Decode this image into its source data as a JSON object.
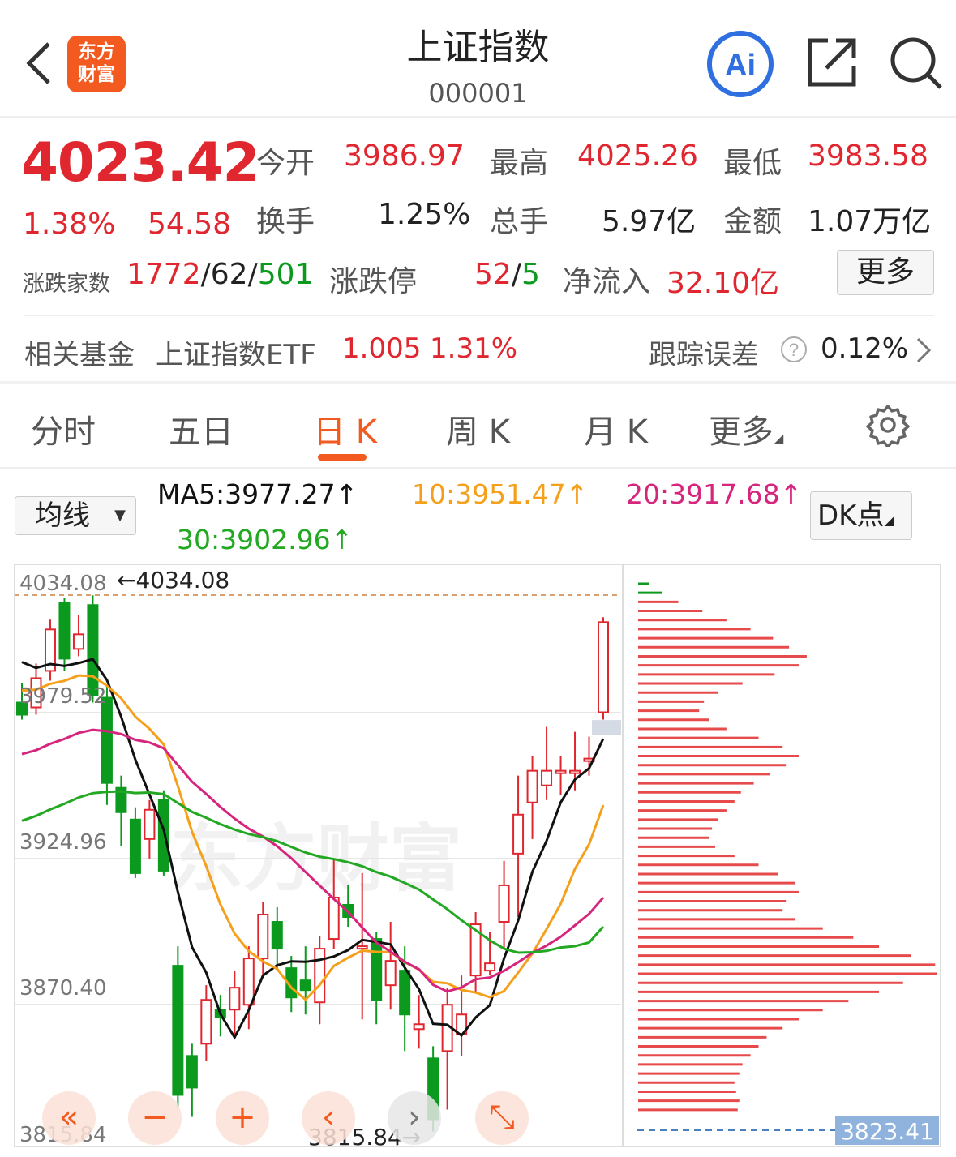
{
  "header": {
    "title": "上证指数",
    "code": "000001",
    "logo_line1": "东方",
    "logo_line2": "财富",
    "ai_label": "Ai"
  },
  "quote": {
    "price": "4023.42",
    "change_pct": "1.38%",
    "change": "54.58",
    "open_label": "今开",
    "open": "3986.97",
    "high_label": "最高",
    "high": "4025.26",
    "low_label": "最低",
    "low": "3983.58",
    "turnover_label": "换手",
    "turnover": "1.25%",
    "volume_label": "总手",
    "volume": "5.97亿",
    "amount_label": "金额",
    "amount": "1.07万亿",
    "breadth_label": "涨跌家数",
    "breadth_up": "1772",
    "breadth_flat": "62",
    "breadth_down": "501",
    "slash": "/",
    "limit_label": "涨跌停",
    "limit_up": "52",
    "limit_down": "5",
    "netflow_label": "净流入",
    "netflow": "32.10亿",
    "more": "更多"
  },
  "fund": {
    "label": "相关基金",
    "name": "上证指数ETF",
    "price": "1.005",
    "change": "1.31%",
    "error_label": "跟踪误差",
    "error": "0.12%"
  },
  "tabs": [
    "分时",
    "五日",
    "日 K",
    "周 K",
    "月 K",
    "更多"
  ],
  "active_tab": 2,
  "ma": {
    "select": "均线",
    "ma5": "MA5:3977.27↑",
    "ma10": "10:3951.47↑",
    "ma20": "20:3917.68↑",
    "ma30": "30:3902.96↑",
    "dk": "DK点"
  },
  "colors": {
    "up": "#e0262f",
    "down": "#0b9a1e",
    "accent": "#f25a1f",
    "ma5": "#111111",
    "ma10": "#f5a01a",
    "ma20": "#d6257d",
    "ma30": "#22a822"
  },
  "chart_data": {
    "type": "candlestick",
    "y_ticks": [
      "4034.08",
      "3979.52",
      "3924.96",
      "3870.40",
      "3815.84"
    ],
    "ylim": [
      3815.84,
      4034.08
    ],
    "max_label": "←4034.08",
    "min_label": "3815.84→",
    "current_price_label": "3823.41",
    "watermark": "东方财富",
    "candles": [
      {
        "o": 3990,
        "c": 3985,
        "h": 3998,
        "l": 3983
      },
      {
        "o": 3988,
        "c": 4000,
        "h": 4006,
        "l": 3985
      },
      {
        "o": 4003,
        "c": 4020,
        "h": 4024,
        "l": 3999
      },
      {
        "o": 4031,
        "c": 4008,
        "h": 4033,
        "l": 4003
      },
      {
        "o": 4012,
        "c": 4018,
        "h": 4026,
        "l": 4009
      },
      {
        "o": 4030,
        "c": 3993,
        "h": 4034,
        "l": 3990
      },
      {
        "o": 3992,
        "c": 3957,
        "h": 3997,
        "l": 3948
      },
      {
        "o": 3955,
        "c": 3945,
        "h": 3960,
        "l": 3931
      },
      {
        "o": 3942,
        "c": 3920,
        "h": 3947,
        "l": 3918
      },
      {
        "o": 3934,
        "c": 3946,
        "h": 3950,
        "l": 3926
      },
      {
        "o": 3950,
        "c": 3921,
        "h": 3954,
        "l": 3919
      },
      {
        "o": 3882,
        "c": 3829,
        "h": 3890,
        "l": 3824
      },
      {
        "o": 3845,
        "c": 3832,
        "h": 3850,
        "l": 3820
      },
      {
        "o": 3850,
        "c": 3868,
        "h": 3874,
        "l": 3843
      },
      {
        "o": 3864,
        "c": 3861,
        "h": 3870,
        "l": 3853
      },
      {
        "o": 3864,
        "c": 3873,
        "h": 3880,
        "l": 3853
      },
      {
        "o": 3866,
        "c": 3885,
        "h": 3890,
        "l": 3856
      },
      {
        "o": 3885,
        "c": 3903,
        "h": 3908,
        "l": 3878
      },
      {
        "o": 3900,
        "c": 3889,
        "h": 3906,
        "l": 3880
      },
      {
        "o": 3881,
        "c": 3869,
        "h": 3886,
        "l": 3863
      },
      {
        "o": 3876,
        "c": 3872,
        "h": 3890,
        "l": 3862
      },
      {
        "o": 3867,
        "c": 3889,
        "h": 3894,
        "l": 3858
      },
      {
        "o": 3893,
        "c": 3910,
        "h": 3926,
        "l": 3889
      },
      {
        "o": 3907,
        "c": 3902,
        "h": 3915,
        "l": 3898
      },
      {
        "o": 3890,
        "c": 3890,
        "h": 3920,
        "l": 3860
      },
      {
        "o": 3893,
        "c": 3868,
        "h": 3896,
        "l": 3858
      },
      {
        "o": 3874,
        "c": 3884,
        "h": 3900,
        "l": 3864
      },
      {
        "o": 3880,
        "c": 3862,
        "h": 3890,
        "l": 3847
      },
      {
        "o": 3856,
        "c": 3858,
        "h": 3870,
        "l": 3848
      },
      {
        "o": 3844,
        "c": 3819,
        "h": 3849,
        "l": 3814
      },
      {
        "o": 3847,
        "c": 3866,
        "h": 3873,
        "l": 3823
      },
      {
        "o": 3854,
        "c": 3862,
        "h": 3878,
        "l": 3845
      },
      {
        "o": 3878,
        "c": 3899,
        "h": 3904,
        "l": 3871
      },
      {
        "o": 3880,
        "c": 3883,
        "h": 3896,
        "l": 3878
      },
      {
        "o": 3900,
        "c": 3915,
        "h": 3925,
        "l": 3889
      },
      {
        "o": 3928,
        "c": 3944,
        "h": 3960,
        "l": 3902
      },
      {
        "o": 3949,
        "c": 3962,
        "h": 3968,
        "l": 3934
      },
      {
        "o": 3956,
        "c": 3962,
        "h": 3980,
        "l": 3950
      },
      {
        "o": 3961,
        "c": 3962,
        "h": 3968,
        "l": 3952
      },
      {
        "o": 3962,
        "c": 3962,
        "h": 3978,
        "l": 3954
      },
      {
        "o": 3966,
        "c": 3967,
        "h": 3976,
        "l": 3960
      },
      {
        "o": 3986,
        "c": 4023,
        "h": 4025,
        "l": 3983
      }
    ]
  }
}
